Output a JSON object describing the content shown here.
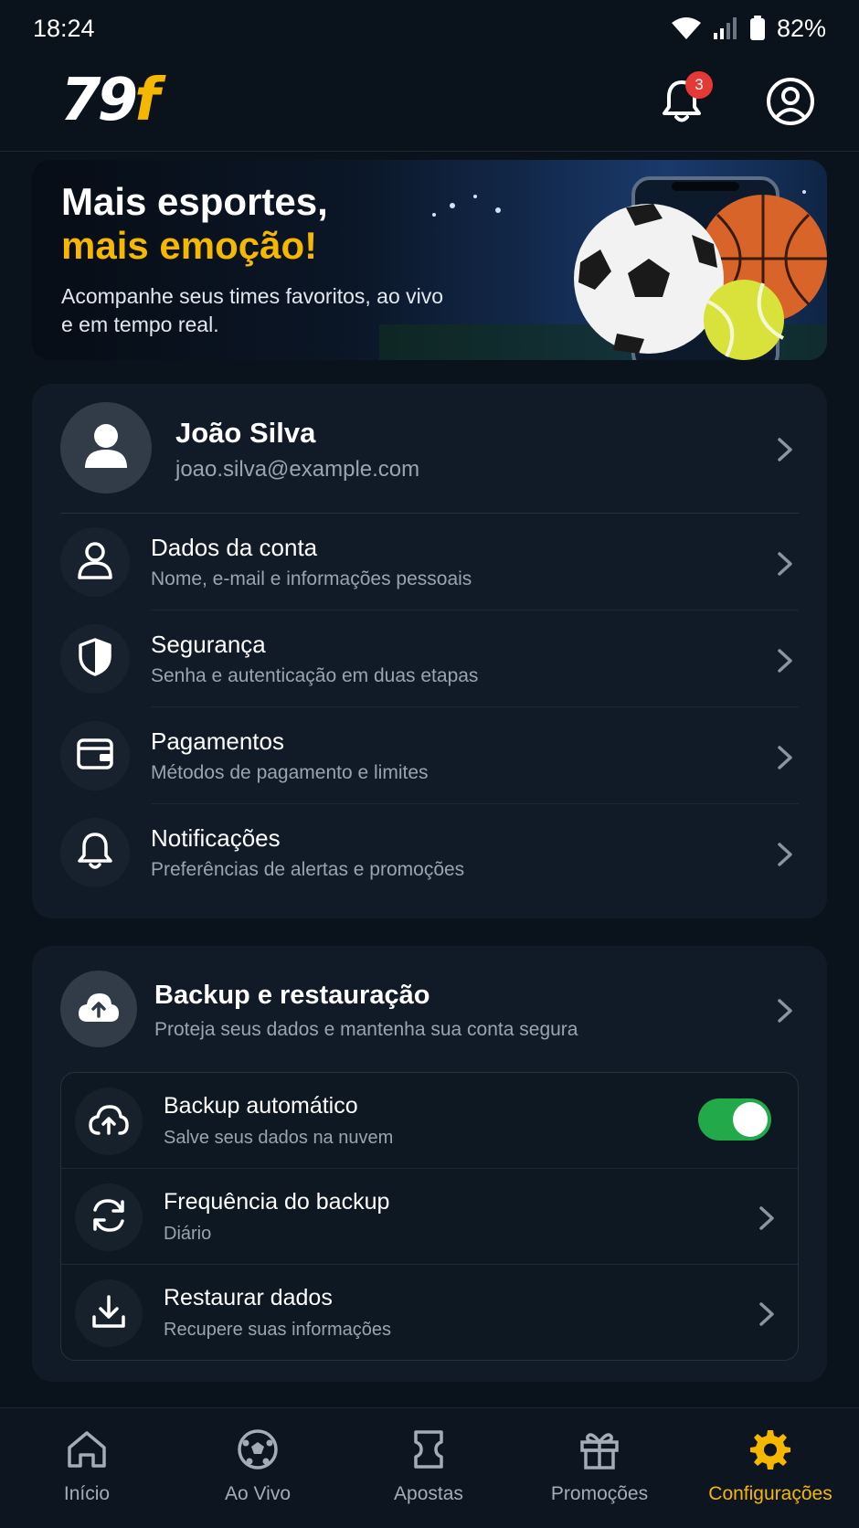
{
  "status_bar": {
    "time": "18:24",
    "battery": "82%"
  },
  "header": {
    "logo_number": "79",
    "logo_letter": "f",
    "notification_count": "3"
  },
  "banner": {
    "title_line1": "Mais esportes,",
    "title_line2": "mais emoção!",
    "subtitle": "Acompanhe seus times favoritos, ao vivo e em tempo real."
  },
  "profile": {
    "name": "João Silva",
    "email": "joao.silva@example.com"
  },
  "account_menu": [
    {
      "title": "Dados da conta",
      "subtitle": "Nome, e-mail e informações pessoais",
      "icon": "user-icon"
    },
    {
      "title": "Segurança",
      "subtitle": "Senha e autenticação em duas etapas",
      "icon": "shield-icon"
    },
    {
      "title": "Pagamentos",
      "subtitle": "Métodos de pagamento e limites",
      "icon": "wallet-icon"
    },
    {
      "title": "Notificações",
      "subtitle": "Preferências de alertas e promoções",
      "icon": "bell-icon"
    }
  ],
  "backup": {
    "title": "Backup e restauração",
    "subtitle": "Proteja seus dados e mantenha sua conta segura",
    "items": [
      {
        "title": "Backup automático",
        "subtitle": "Salve seus dados na nuvem",
        "toggle_on": true,
        "icon": "cloud-upload-icon"
      },
      {
        "title": "Frequência do backup",
        "subtitle": "Diário",
        "icon": "refresh-icon"
      },
      {
        "title": "Restaurar dados",
        "subtitle": "Recupere suas informações",
        "icon": "download-icon"
      }
    ]
  },
  "bottom_nav": [
    {
      "label": "Início",
      "icon": "home-icon",
      "active": false
    },
    {
      "label": "Ao Vivo",
      "icon": "soccer-ball-icon",
      "active": false
    },
    {
      "label": "Apostas",
      "icon": "ticket-icon",
      "active": false
    },
    {
      "label": "Promoções",
      "icon": "gift-icon",
      "active": false
    },
    {
      "label": "Configurações",
      "icon": "gear-icon",
      "active": true
    }
  ],
  "colors": {
    "accent": "#f5b700",
    "background": "#0a121b",
    "card": "#111b27",
    "toggle_on": "#22a94a",
    "badge": "#e53935"
  }
}
